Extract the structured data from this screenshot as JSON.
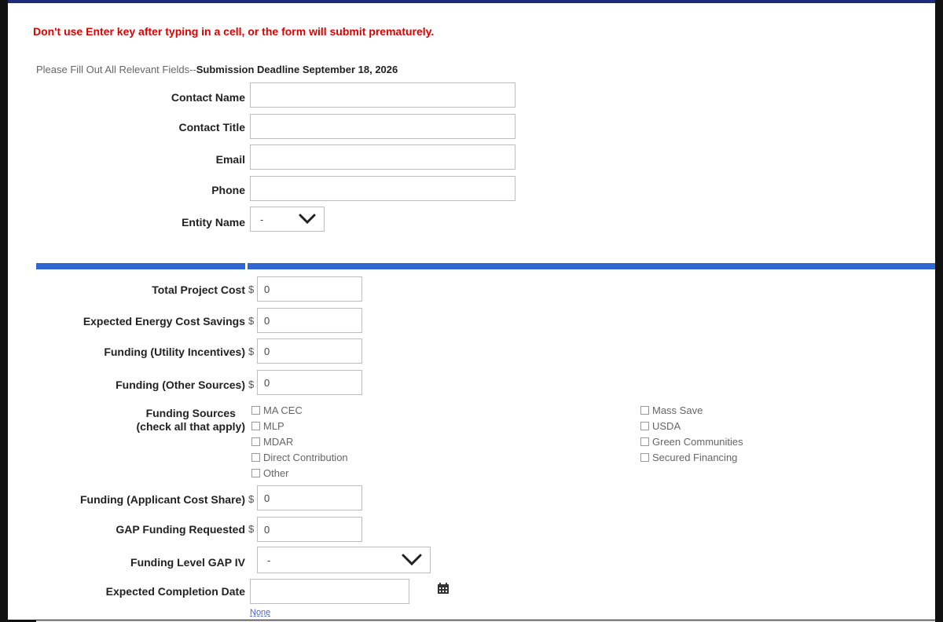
{
  "warning": "Don't use Enter key after typing in a cell, or the form will submit prematurely.",
  "intro": {
    "prefix": "Please Fill Out All Relevant Fields--",
    "deadline": "Submission Deadline September 18, 2026"
  },
  "contact": {
    "name_label": "Contact Name",
    "title_label": "Contact Title",
    "email_label": "Email",
    "phone_label": "Phone",
    "entity_label": "Entity Name",
    "entity_value": "-"
  },
  "project": {
    "currency": "$",
    "total_cost_label": "Total Project Cost",
    "total_cost_value": "0",
    "savings_label": "Expected Energy Cost Savings",
    "savings_value": "0",
    "utility_label": "Funding (Utility Incentives)",
    "utility_value": "0",
    "other_label": "Funding (Other Sources)",
    "other_value": "0",
    "sources_label_1": "Funding Sources",
    "sources_label_2": "(check all that apply)",
    "sources_left": [
      "MA CEC",
      "MLP",
      "MDAR",
      "Direct Contribution",
      "Other"
    ],
    "sources_right": [
      "Mass Save",
      "USDA",
      "Green Communities",
      "Secured Financing"
    ],
    "applicant_label": "Funding (Applicant Cost Share)",
    "applicant_value": "0",
    "gap_label": "GAP Funding Requested",
    "gap_value": "0",
    "level_label": "Funding Level GAP IV",
    "level_value": "-",
    "completion_label": "Expected Completion Date",
    "none_link": "None"
  },
  "icons": {
    "dropdown": "chevron-down-icon",
    "calendar": "calendar-icon"
  },
  "colors": {
    "warning": "#e00000",
    "separator": "#2f66d1",
    "top_border": "#1f2b7a"
  }
}
